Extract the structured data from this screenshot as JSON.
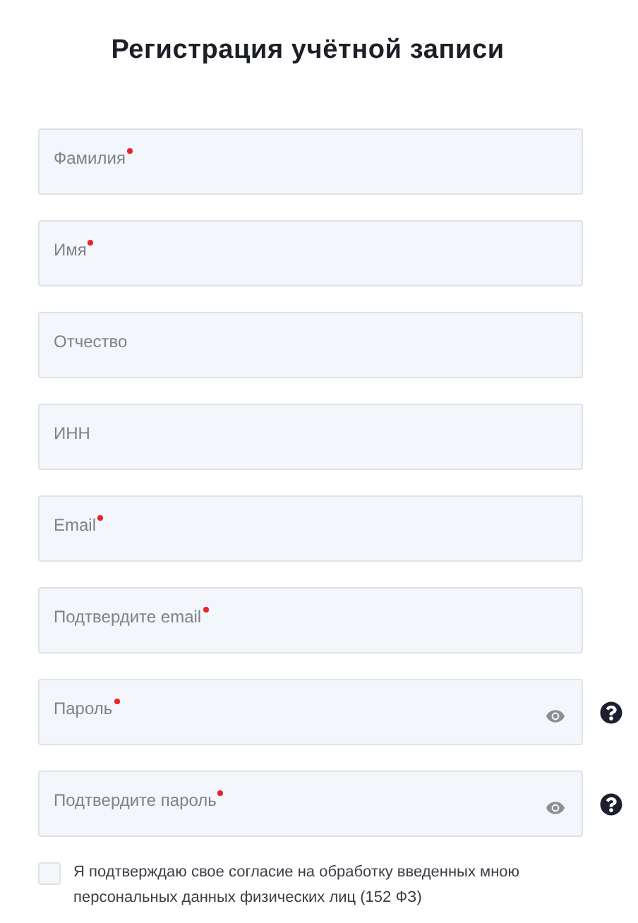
{
  "title": "Регистрация учётной записи",
  "fields": [
    {
      "kind": "text",
      "label": "Фамилия",
      "required": true
    },
    {
      "kind": "text",
      "label": "Имя",
      "required": true
    },
    {
      "kind": "text",
      "label": "Отчество",
      "required": false
    },
    {
      "kind": "text",
      "label": "ИНН",
      "required": false
    },
    {
      "kind": "text",
      "label": "Email",
      "required": true
    },
    {
      "kind": "text",
      "label": "Подтвердите email",
      "required": true
    },
    {
      "kind": "password",
      "label": "Пароль",
      "required": true
    },
    {
      "kind": "password",
      "label": "Подтвердите пароль",
      "required": true
    }
  ],
  "consent": {
    "checked": false,
    "text": "Я подтверждаю свое согласие на обработку введенных мною персональных данных физических лиц (152 ФЗ)"
  }
}
